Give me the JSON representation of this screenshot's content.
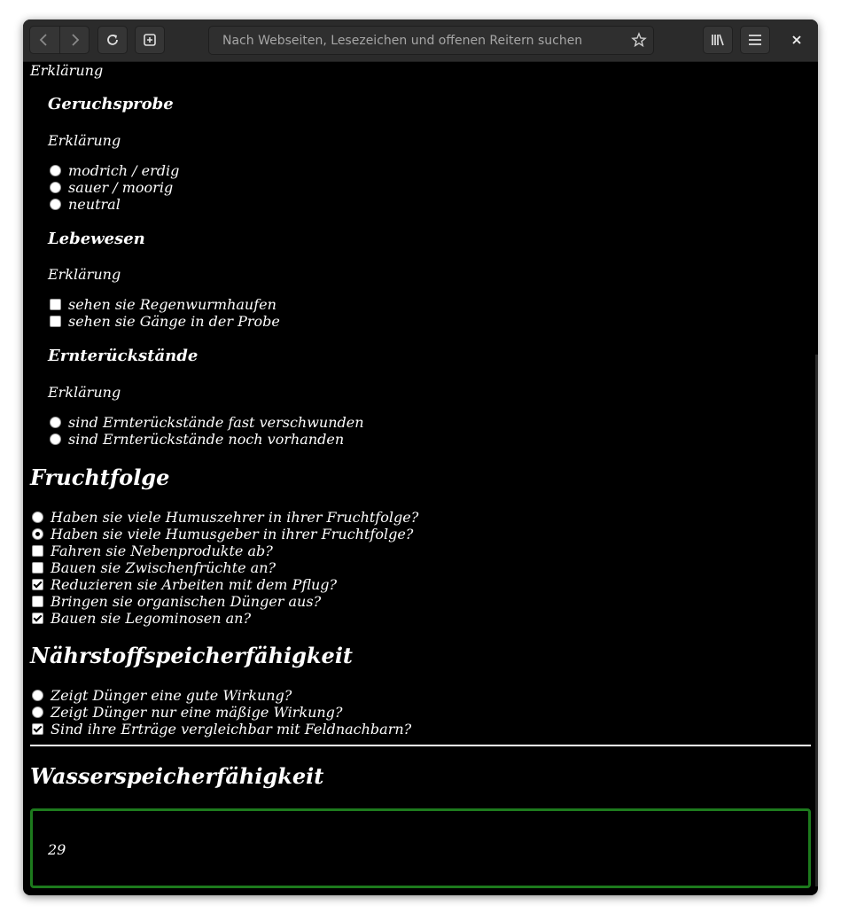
{
  "browser": {
    "url_placeholder": "Nach Webseiten, Lesezeichen und offenen Reitern suchen",
    "icons": [
      "back-icon",
      "forward-icon",
      "reload-icon",
      "new-tab-icon",
      "star-icon",
      "library-icon",
      "hamburger-menu-icon",
      "close-icon"
    ]
  },
  "page": {
    "top_explanation": "Erklärung",
    "geruch": {
      "title": "Geruchsprobe",
      "explanation": "Erklärung",
      "options": [
        "modrich / erdig",
        "sauer / moorig",
        "neutral"
      ]
    },
    "lebewesen": {
      "title": "Lebewesen",
      "explanation": "Erklärung",
      "options": [
        "sehen sie Regenwurmhaufen",
        "sehen sie Gänge in der Probe"
      ]
    },
    "ernte": {
      "title": "Ernterückstände",
      "explanation": "Erklärung",
      "options": [
        "sind Ernterückstände fast verschwunden",
        "sind Ernterückstände noch vorhanden"
      ]
    },
    "fruchtfolge": {
      "title": "Fruchtfolge",
      "options": [
        "Haben sie viele Humuszehrer in ihrer Fruchtfolge?",
        "Haben sie viele Humusgeber in ihrer Fruchtfolge?",
        "Fahren sie Nebenprodukte ab?",
        "Bauen sie Zwischenfrüchte an?",
        "Reduzieren sie Arbeiten mit dem Pflug?",
        "Bringen sie organischen Dünger aus?",
        "Bauen sie Legominosen an?"
      ],
      "state": [
        false,
        true,
        false,
        false,
        true,
        false,
        true
      ]
    },
    "naehrstoff": {
      "title": "Nährstoffspeicherfähigkeit",
      "options": [
        "Zeigt Dünger eine gute Wirkung?",
        "Zeigt Dünger nur eine mäßige Wirkung?",
        "Sind ihre Erträge vergleichbar mit Feldnachbarn?"
      ],
      "state": [
        false,
        false,
        true
      ]
    },
    "wasser": {
      "title": "Wasserspeicherfähigkeit",
      "result": "29"
    }
  },
  "colors": {
    "background": "#000000",
    "text": "#ffffff",
    "result_border": "#1d7a1d",
    "toolbar": "#2b2b2b"
  }
}
